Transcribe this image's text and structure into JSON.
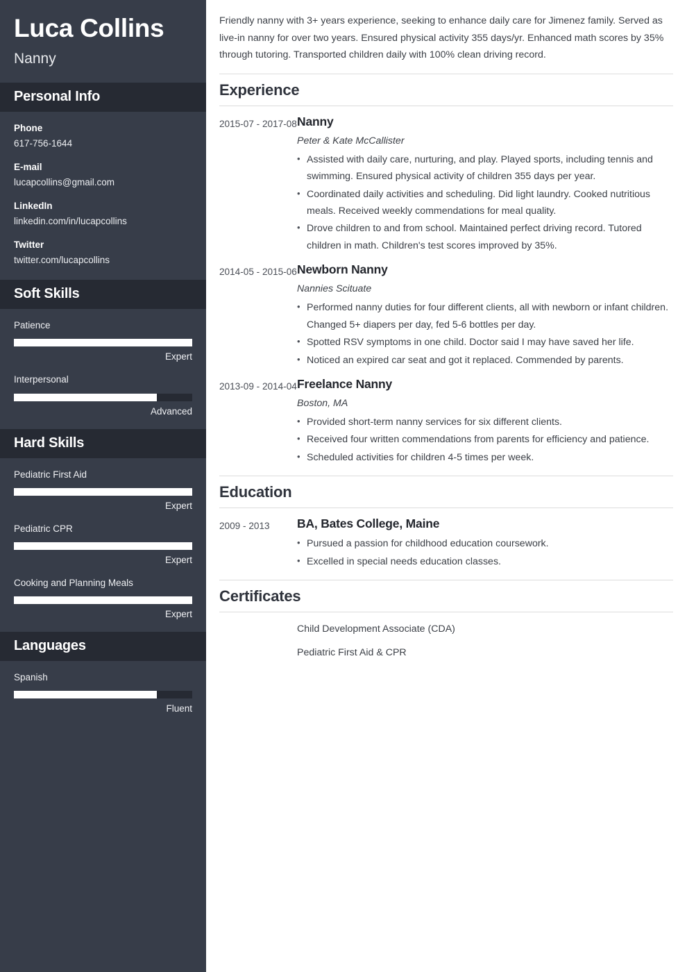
{
  "sidebar": {
    "full_name": "Luca Collins",
    "job_title": "Nanny",
    "personal_info": {
      "heading": "Personal Info",
      "items": [
        {
          "label": "Phone",
          "value": "617-756-1644"
        },
        {
          "label": "E-mail",
          "value": "lucapcollins@gmail.com"
        },
        {
          "label": "LinkedIn",
          "value": "linkedin.com/in/lucapcollins"
        },
        {
          "label": "Twitter",
          "value": "twitter.com/lucapcollins"
        }
      ]
    },
    "soft_skills": {
      "heading": "Soft Skills",
      "items": [
        {
          "name": "Patience",
          "level": "Expert",
          "percent": 100
        },
        {
          "name": "Interpersonal",
          "level": "Advanced",
          "percent": 80
        }
      ]
    },
    "hard_skills": {
      "heading": "Hard Skills",
      "items": [
        {
          "name": "Pediatric First Aid",
          "level": "Expert",
          "percent": 100
        },
        {
          "name": "Pediatric CPR",
          "level": "Expert",
          "percent": 100
        },
        {
          "name": "Cooking and Planning Meals",
          "level": "Expert",
          "percent": 100
        }
      ]
    },
    "languages": {
      "heading": "Languages",
      "items": [
        {
          "name": "Spanish",
          "level": "Fluent",
          "percent": 80
        }
      ]
    }
  },
  "main": {
    "summary": "Friendly nanny with 3+ years experience, seeking to enhance daily care for Jimenez family. Served as live-in nanny for over two years. Ensured physical activity 355 days/yr. Enhanced math scores by 35% through tutoring. Transported children daily with 100% clean driving record.",
    "experience": {
      "heading": "Experience",
      "entries": [
        {
          "date": "2015-07 - 2017-08",
          "role": "Nanny",
          "org": "Peter & Kate McCallister",
          "bullets": [
            "Assisted with daily care, nurturing, and play. Played sports, including tennis and swimming. Ensured physical activity of children 355 days per year.",
            "Coordinated daily activities and scheduling. Did light laundry. Cooked nutritious meals. Received weekly commendations for meal quality.",
            "Drove children to and from school. Maintained perfect driving record. Tutored children in math. Children's test scores improved by 35%."
          ]
        },
        {
          "date": "2014-05 - 2015-06",
          "role": "Newborn Nanny",
          "org": "Nannies Scituate",
          "bullets": [
            "Performed nanny duties for four different clients, all with newborn or infant children. Changed 5+ diapers per day, fed 5-6 bottles per day.",
            "Spotted RSV symptoms in one child. Doctor said I may have saved her life.",
            "Noticed an expired car seat and got it replaced. Commended by parents."
          ]
        },
        {
          "date": "2013-09 - 2014-04",
          "role": "Freelance Nanny",
          "org": "Boston, MA",
          "bullets": [
            "Provided short-term nanny services for six different clients.",
            "Received four written commendations from parents for efficiency and patience.",
            "Scheduled activities for children 4-5 times per week."
          ]
        }
      ]
    },
    "education": {
      "heading": "Education",
      "entries": [
        {
          "date": "2009 - 2013",
          "degree": "BA, Bates College, Maine",
          "bullets": [
            "Pursued a passion for childhood education coursework.",
            "Excelled in special needs education classes."
          ]
        }
      ]
    },
    "certificates": {
      "heading": "Certificates",
      "items": [
        "Child Development Associate (CDA)",
        "Pediatric First Aid & CPR"
      ]
    }
  }
}
